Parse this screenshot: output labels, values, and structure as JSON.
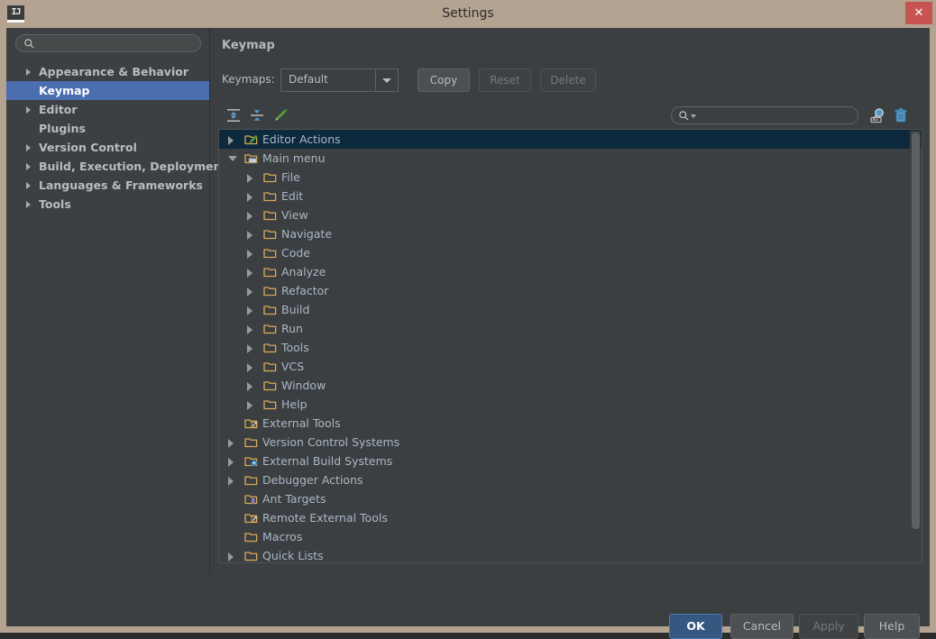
{
  "window": {
    "title": "Settings",
    "app_icon": "IJ",
    "close_label": "✕",
    "colors": {
      "titlebar": "#b5a391",
      "panel": "#3c3f41",
      "sidebar": "#3c4043",
      "sidebar_selection": "#4b6eaf",
      "tree_selection": "#0d293e",
      "close_button": "#c75450",
      "default_button": "#365880",
      "text": "#bbbbbb",
      "tree_text": "#a9b7c6",
      "folder_icon": "#d9a957"
    }
  },
  "sidebar": {
    "search_placeholder": "",
    "search_value": "",
    "items": [
      {
        "label": "Appearance & Behavior",
        "expandable": true,
        "selected": false
      },
      {
        "label": "Keymap",
        "expandable": false,
        "selected": true
      },
      {
        "label": "Editor",
        "expandable": true,
        "selected": false
      },
      {
        "label": "Plugins",
        "expandable": false,
        "selected": false
      },
      {
        "label": "Version Control",
        "expandable": true,
        "selected": false
      },
      {
        "label": "Build, Execution, Deployment",
        "expandable": true,
        "selected": false
      },
      {
        "label": "Languages & Frameworks",
        "expandable": true,
        "selected": false
      },
      {
        "label": "Tools",
        "expandable": true,
        "selected": false
      }
    ]
  },
  "main": {
    "title": "Keymap",
    "keymaps": {
      "label": "Keymaps:",
      "selected": "Default",
      "options": [
        "Default"
      ],
      "buttons": [
        {
          "label": "Copy",
          "enabled": true
        },
        {
          "label": "Reset",
          "enabled": false
        },
        {
          "label": "Delete",
          "enabled": false
        }
      ]
    },
    "toolbar": {
      "expand_all_icon": "expand-all-icon",
      "collapse_all_icon": "collapse-all-icon",
      "edit_shortcut_icon": "edit-pencil-icon",
      "search_placeholder": "",
      "search_value": "",
      "find_by_shortcut_icon": "find-by-shortcut-icon",
      "clear_icon": "trash-icon"
    },
    "tree": [
      {
        "label": "Editor Actions",
        "indent": 0,
        "arrow": "closed",
        "icon": "folder-pencil",
        "selected": true
      },
      {
        "label": "Main menu",
        "indent": 0,
        "arrow": "open",
        "icon": "folder-menu",
        "selected": false
      },
      {
        "label": "File",
        "indent": 1,
        "arrow": "closed",
        "icon": "folder",
        "selected": false
      },
      {
        "label": "Edit",
        "indent": 1,
        "arrow": "closed",
        "icon": "folder",
        "selected": false
      },
      {
        "label": "View",
        "indent": 1,
        "arrow": "closed",
        "icon": "folder",
        "selected": false
      },
      {
        "label": "Navigate",
        "indent": 1,
        "arrow": "closed",
        "icon": "folder",
        "selected": false
      },
      {
        "label": "Code",
        "indent": 1,
        "arrow": "closed",
        "icon": "folder",
        "selected": false
      },
      {
        "label": "Analyze",
        "indent": 1,
        "arrow": "closed",
        "icon": "folder",
        "selected": false
      },
      {
        "label": "Refactor",
        "indent": 1,
        "arrow": "closed",
        "icon": "folder",
        "selected": false
      },
      {
        "label": "Build",
        "indent": 1,
        "arrow": "closed",
        "icon": "folder",
        "selected": false
      },
      {
        "label": "Run",
        "indent": 1,
        "arrow": "closed",
        "icon": "folder",
        "selected": false
      },
      {
        "label": "Tools",
        "indent": 1,
        "arrow": "closed",
        "icon": "folder",
        "selected": false
      },
      {
        "label": "VCS",
        "indent": 1,
        "arrow": "closed",
        "icon": "folder",
        "selected": false
      },
      {
        "label": "Window",
        "indent": 1,
        "arrow": "closed",
        "icon": "folder",
        "selected": false
      },
      {
        "label": "Help",
        "indent": 1,
        "arrow": "closed",
        "icon": "folder",
        "selected": false
      },
      {
        "label": "External Tools",
        "indent": 0,
        "arrow": "none",
        "icon": "folder-tools",
        "selected": false
      },
      {
        "label": "Version Control Systems",
        "indent": 0,
        "arrow": "closed",
        "icon": "folder",
        "selected": false
      },
      {
        "label": "External Build Systems",
        "indent": 0,
        "arrow": "closed",
        "icon": "folder-gear",
        "selected": false
      },
      {
        "label": "Debugger Actions",
        "indent": 0,
        "arrow": "closed",
        "icon": "folder",
        "selected": false
      },
      {
        "label": "Ant Targets",
        "indent": 0,
        "arrow": "none",
        "icon": "folder-ant",
        "selected": false
      },
      {
        "label": "Remote External Tools",
        "indent": 0,
        "arrow": "none",
        "icon": "folder-tools",
        "selected": false
      },
      {
        "label": "Macros",
        "indent": 0,
        "arrow": "none",
        "icon": "folder",
        "selected": false
      },
      {
        "label": "Quick Lists",
        "indent": 0,
        "arrow": "closed",
        "icon": "folder",
        "selected": false
      }
    ]
  },
  "footer": {
    "buttons": [
      {
        "id": "ok",
        "label": "OK",
        "enabled": true,
        "default": true
      },
      {
        "id": "cancel",
        "label": "Cancel",
        "enabled": true,
        "default": false
      },
      {
        "id": "apply",
        "label": "Apply",
        "enabled": false,
        "default": false
      },
      {
        "id": "help",
        "label": "Help",
        "enabled": true,
        "default": false
      }
    ]
  }
}
